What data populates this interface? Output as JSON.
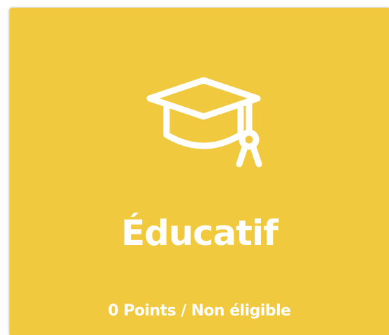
{
  "card": {
    "background_color": "#F0C93E",
    "icon": "graduation-cap-icon",
    "title": "Éducatif",
    "status_text": "0 Points / Non éligible"
  }
}
